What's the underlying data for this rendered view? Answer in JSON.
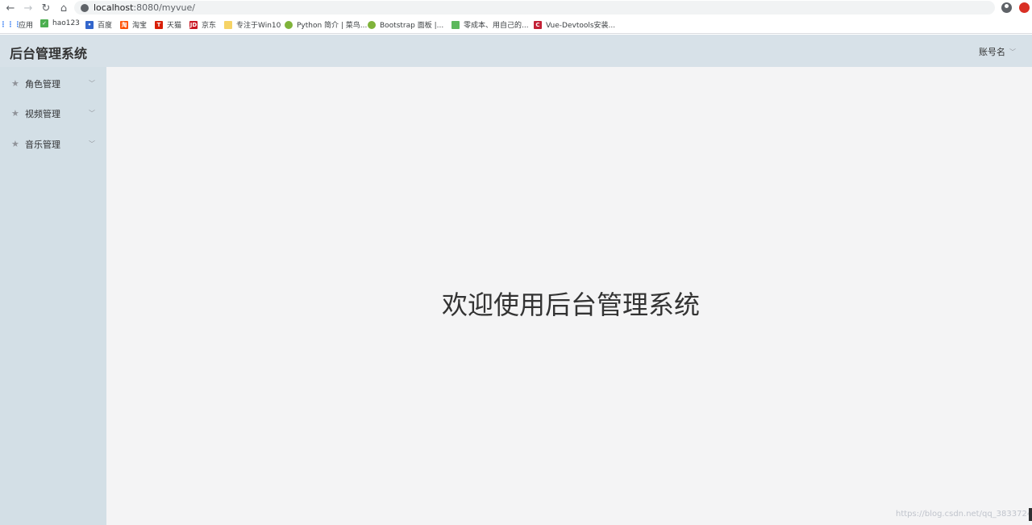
{
  "browser": {
    "url_host": "localhost",
    "url_rest": ":8080/myvue/"
  },
  "bookmarks": [
    {
      "label": "应用",
      "icon": "apps-icon",
      "color": "#4285f4"
    },
    {
      "label": "hao123",
      "icon": "hao123-icon",
      "color": "#4caf50"
    },
    {
      "label": "百度",
      "icon": "baidu-icon",
      "color": "#3366cc"
    },
    {
      "label": "淘宝",
      "icon": "taobao-icon",
      "color": "#ff5000"
    },
    {
      "label": "天猫",
      "icon": "tmall-icon",
      "color": "#d81e06"
    },
    {
      "label": "京东",
      "icon": "jd-icon",
      "color": "#c91623"
    },
    {
      "label": "专注于Win10",
      "icon": "folder-icon",
      "color": "#f6d365"
    },
    {
      "label": "Python 简介 | 菜鸟...",
      "icon": "runoob-icon",
      "color": "#7fb33a"
    },
    {
      "label": "Bootstrap 面板 |...",
      "icon": "runoob-icon",
      "color": "#7fb33a"
    },
    {
      "label": "零成本、用自己的...",
      "icon": "site-icon",
      "color": "#5cb85c"
    },
    {
      "label": "Vue-Devtools安装...",
      "icon": "csdn-icon",
      "color": "#c32136"
    }
  ],
  "header": {
    "title": "后台管理系统",
    "account": "账号名"
  },
  "sidebar": {
    "items": [
      {
        "label": "角色管理"
      },
      {
        "label": "视频管理"
      },
      {
        "label": "音乐管理"
      }
    ]
  },
  "main": {
    "welcome": "欢迎使用后台管理系统"
  },
  "watermark": "https://blog.csdn.net/qq_38337245"
}
